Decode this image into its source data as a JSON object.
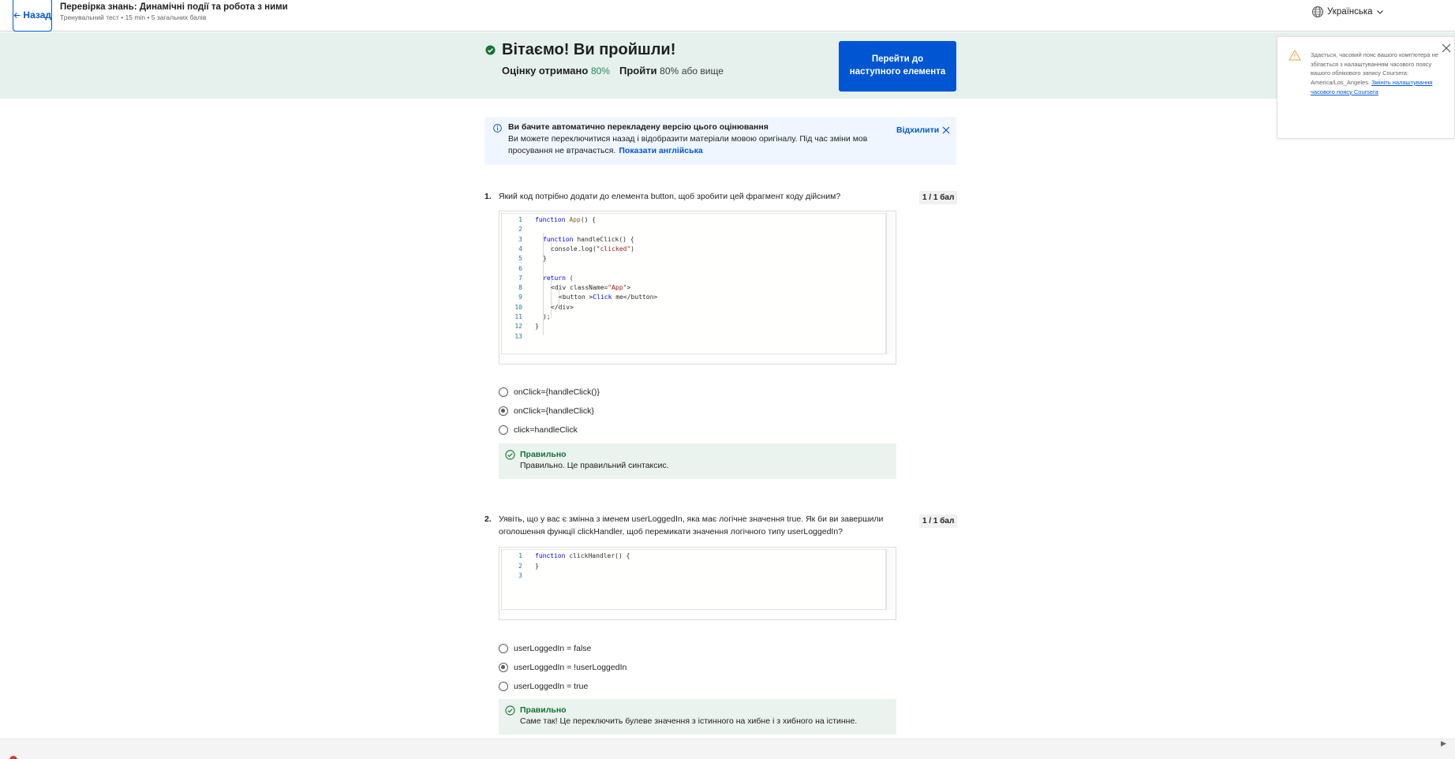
{
  "header": {
    "back_label": "Назад",
    "title": "Перевірка знань: Динамічні події та робота з ними",
    "meta": "Тренувальний тест • 15 min • 5 загальних балів",
    "language": "Українська"
  },
  "banner": {
    "title": "Вітаємо! Ви пройшли!",
    "grade_label": "Оцінку отримано",
    "grade_value": "80%",
    "pass_label": "Пройти",
    "pass_value": "80%",
    "pass_suffix": "або вище",
    "next_button": "Перейти до наступного елемента"
  },
  "timezone_toast": {
    "text": "Здається, часовий пояс вашого комп'ютера не збігається з налаштуванням часового поясу вашого облікового запису Coursera: America/Los_Angeles.",
    "link": "Змініть налаштування часового поясу Coursera"
  },
  "translation_notice": {
    "title": "Ви бачите автоматично перекладену версію цього оцінювання",
    "body": "Ви можете переключитися назад і відобразити матеріали мовою оригіналу. Під час зміни мов просування не втрачається.",
    "show_english": "Показати англійська",
    "dismiss": "Відхилити"
  },
  "questions": [
    {
      "number": "1.",
      "text": "Який код потрібно додати до елемента button, щоб зробити цей фрагмент коду дійсним?",
      "points": "1 / 1 бал",
      "code_lines": [
        "1",
        "2",
        "3",
        "4",
        "5",
        "6",
        "7",
        "8",
        "9",
        "10",
        "11",
        "12",
        "13"
      ],
      "options": [
        "onClick={handleClick()}",
        "onClick={handleClick}",
        "click=handleClick"
      ],
      "selected": 1,
      "feedback_title": "Правильно",
      "feedback_text": "Правильно. Це правильний синтаксис."
    },
    {
      "number": "2.",
      "text_line1": "Уявіть, що у вас є змінна з іменем userLoggedIn, яка має логічне значення true. Як би ви завершили",
      "text_line2": "оголошення функції clickHandler, щоб перемикати значення логічного типу userLoggedIn?",
      "points": "1 / 1 бал",
      "code_lines": [
        "1",
        "2",
        "3"
      ],
      "options": [
        "userLoggedIn = false",
        "userLoggedIn = !userLoggedIn",
        "userLoggedIn = true"
      ],
      "selected": 1,
      "feedback_title": "Правильно",
      "feedback_text": "Саме так! Це переключить булеве значення з істинного на хибне і з хибного на істинне."
    }
  ],
  "code1": {
    "l1_kw": "function",
    "l1_fn": "App",
    "l1_rest": "() {",
    "l3_kw": "function",
    "l3_rest": "handleClick() {",
    "l4_a": "console.log(",
    "l4_str": "\"clicked\"",
    "l4_b": ")",
    "l5": "}",
    "l7_kw": "return",
    "l7_rest": "(",
    "l8_a": "<div className=",
    "l8_str": "\"App\"",
    "l8_b": ">",
    "l9_a": "<button >",
    "l9_kw": "Click",
    "l9_b": " me</button>",
    "l10": "</div>",
    "l11": ");",
    "l12": "}"
  },
  "code2": {
    "l1_kw": "function",
    "l1_rest": "clickHandler() {",
    "l2": "}"
  },
  "colors": {
    "accent": "#0056d2",
    "banner_bg": "#e6f0ec",
    "success": "#137333",
    "feedback_bg": "#eaf3ee",
    "notice_bg": "#f0f6ff"
  }
}
